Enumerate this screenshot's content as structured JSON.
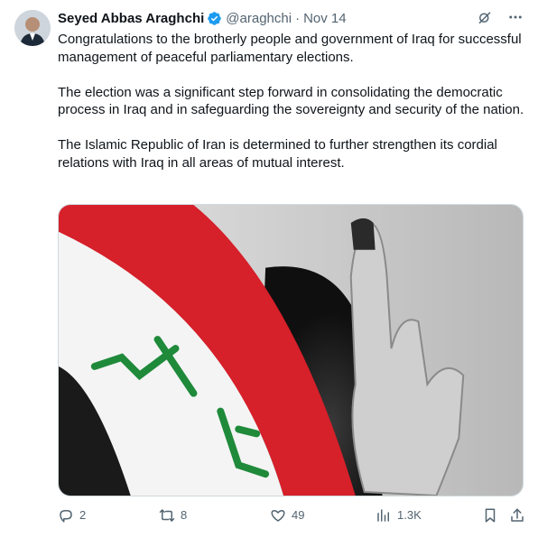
{
  "author": {
    "name": "Seyed Abbas Araghchi",
    "handle": "@araghchi",
    "separator": "·",
    "date": "Nov 14"
  },
  "tweet": {
    "paragraphs": [
      "Congratulations to the brotherly people and government of Iraq for successful management of peaceful parliamentary elections.",
      "The election was a significant step forward in consolidating the democratic process in Iraq and in safeguarding the sovereignty and security of the nation.",
      "The Islamic Republic of Iran is determined to further strengthen its cordial relations with Iraq in all areas of mutual interest."
    ]
  },
  "media": {
    "flag_colors": {
      "red": "#d6202a",
      "white": "#f4f4f4",
      "black": "#1a1a1a",
      "green": "#1f8a3a"
    }
  },
  "actions": {
    "replies": "2",
    "reposts": "8",
    "likes": "49",
    "views": "1.3K"
  },
  "icons": {
    "verified": "verified-badge-icon",
    "grok": "grok-icon",
    "more": "more-icon",
    "reply": "reply-icon",
    "repost": "repost-icon",
    "like": "like-icon",
    "views": "views-icon",
    "bookmark": "bookmark-icon",
    "share": "share-icon"
  },
  "colors": {
    "accent": "#1d9bf0",
    "muted": "#536471",
    "text": "#0f1419"
  }
}
